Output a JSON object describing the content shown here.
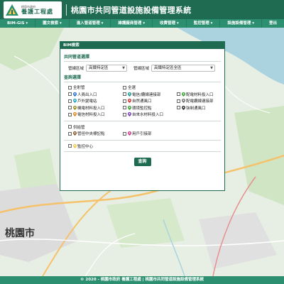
{
  "header": {
    "logo_small": "桃園市政府",
    "logo_name": "養護工程處",
    "title": "桃園市共同管道設施設備管理系統"
  },
  "nav": {
    "items": [
      "BIM-GIS ▾",
      "圖文檢索 ▾",
      "進入管道管理 ▾",
      "維護廠商管理 ▾",
      "收費管理 ▾",
      "監控管理 ▾",
      "設施設備管理 ▾",
      "登出"
    ]
  },
  "map": {
    "city_label": "桃園市"
  },
  "modal": {
    "title": "BIM檢索",
    "section_pipe": "共同管道選擇",
    "area_label_1": "管線區域",
    "area_value_1": "高鐵特定區",
    "area_label_2": "管線區域",
    "area_value_2": "高鐵特定區全區",
    "section_query": "查詢選擇",
    "options": [
      {
        "label": "全射管",
        "icon": null
      },
      {
        "label": "全選",
        "icon": null
      },
      {
        "label": "",
        "icon": null
      },
      {
        "label": "人員出入口",
        "icon": "pin-blue"
      },
      {
        "label": "電信/纜線連接部",
        "icon": "pin-teal"
      },
      {
        "label": "配電材料投入口",
        "icon": "pin-green"
      },
      {
        "label": "戶外變電站",
        "icon": "pin-cyan"
      },
      {
        "label": "自然通風口",
        "icon": "pin-red"
      },
      {
        "label": "配電纜線連接部",
        "icon": "pin-gray"
      },
      {
        "label": "機電材料投入口",
        "icon": "pin-olive"
      },
      {
        "label": "環境監控點",
        "icon": "pin-green"
      },
      {
        "label": "強制通風口",
        "icon": "pin-dark"
      },
      {
        "label": "電信材料投入口",
        "icon": "pin-orange"
      },
      {
        "label": "自來水材料投入口",
        "icon": "pin-purple"
      }
    ],
    "options2": [
      {
        "label": "供給管",
        "icon": null
      },
      {
        "label": "",
        "icon": null
      },
      {
        "label": "管徑中央標記點",
        "icon": "pin-brown"
      },
      {
        "label": "用戶引接部",
        "icon": "pin-pink"
      }
    ],
    "option_monitor": "監控中心",
    "query_button": "查詢"
  },
  "footer": {
    "text": "© 2020 - 桃園市政府 養護工程處 | 桃園市共同管道設施設備管理系統"
  },
  "colors": {
    "brand": "#1e6b52",
    "nav": "#2b8f70",
    "pin-blue": "#2a6fd6",
    "pin-teal": "#1f9c95",
    "pin-green": "#3aa43a",
    "pin-cyan": "#21a7c9",
    "pin-red": "#d43a3a",
    "pin-gray": "#777777",
    "pin-olive": "#9a8f1f",
    "pin-dark": "#333333",
    "pin-orange": "#e08a1e",
    "pin-purple": "#7a3ec4",
    "pin-brown": "#8b5a2b",
    "pin-pink": "#d23c8a"
  }
}
